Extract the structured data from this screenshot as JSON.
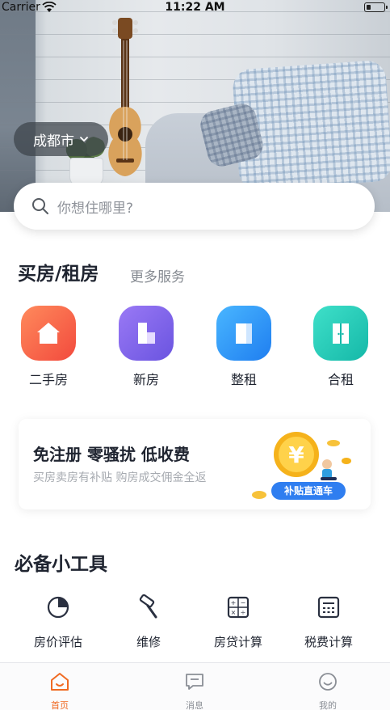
{
  "status_bar": {
    "carrier": "Carrier",
    "time": "11:22 AM"
  },
  "hero": {
    "city": "成都市"
  },
  "search": {
    "placeholder": "你想住哪里?"
  },
  "buy_rent": {
    "title": "买房/租房",
    "more": "更多服务",
    "categories": [
      {
        "label": "二手房",
        "icon": "home-icon",
        "color_from": "#ff8a5c",
        "color_to": "#f24a3d"
      },
      {
        "label": "新房",
        "icon": "building-icon",
        "color_from": "#9a79f5",
        "color_to": "#6a54e0"
      },
      {
        "label": "整租",
        "icon": "apartment-icon",
        "color_from": "#49b6ff",
        "color_to": "#1f7ef0"
      },
      {
        "label": "合租",
        "icon": "door-icon",
        "color_from": "#3fe0c9",
        "color_to": "#15b8a8"
      }
    ]
  },
  "promo": {
    "headline": "免注册 零骚扰 低收费",
    "subtext": "买房卖房有补贴 购房成交佣金全返",
    "badge": "补贴直通车",
    "coin_symbol": "¥"
  },
  "tools": {
    "title": "必备小工具",
    "items": [
      {
        "label": "房价评估",
        "icon": "pie-chart-icon"
      },
      {
        "label": "维修",
        "icon": "hammer-icon"
      },
      {
        "label": "房贷计算",
        "icon": "calculator-icon"
      },
      {
        "label": "税费计算",
        "icon": "tax-calculator-icon"
      }
    ]
  },
  "tab_bar": {
    "tabs": [
      {
        "label": "首页",
        "icon": "home-tab-icon",
        "active": true
      },
      {
        "label": "消息",
        "icon": "message-icon",
        "active": false
      },
      {
        "label": "我的",
        "icon": "profile-icon",
        "active": false
      }
    ]
  },
  "colors": {
    "accent": "#f06a22",
    "promo_pill": "#2f7ef0"
  }
}
